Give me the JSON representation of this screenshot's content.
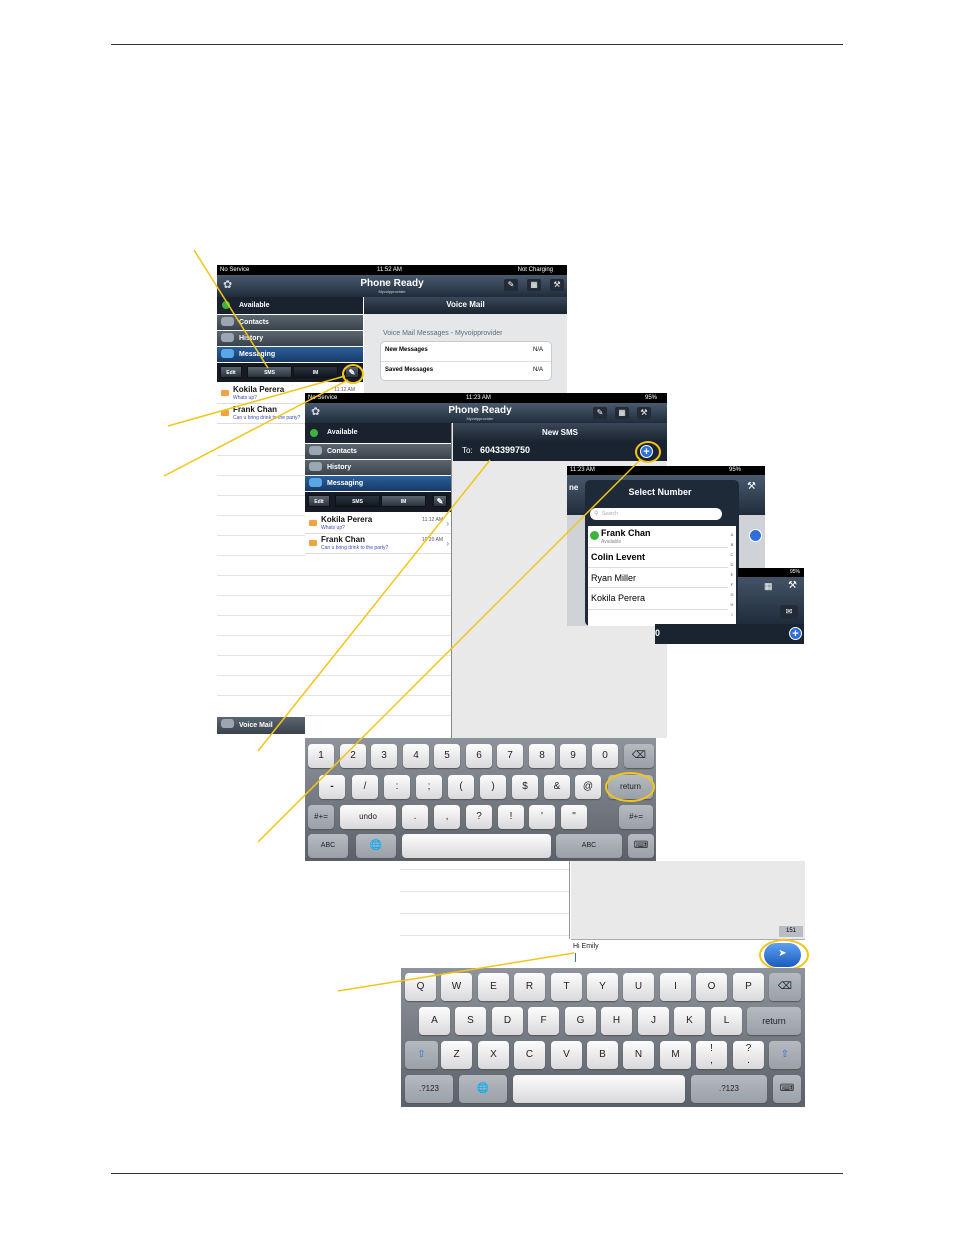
{
  "screen1": {
    "status_left": "No Service",
    "status_time": "11:52 AM",
    "status_right": "Not Charging",
    "title": "Phone Ready",
    "subtitle": "Myvoipprovider",
    "presence": "Available",
    "nav": [
      "Contacts",
      "History",
      "Messaging"
    ],
    "seg": [
      "Edit",
      "SMS",
      "IM"
    ],
    "panel_title": "Voice Mail",
    "vm_heading": "Voice Mail Messages - Myvoipprovider",
    "vm_rows": [
      {
        "label": "New Messages",
        "value": "N/A"
      },
      {
        "label": "Saved Messages",
        "value": "N/A"
      }
    ],
    "messages": [
      {
        "name": "Kokila Perera",
        "text": "Whats up?",
        "time": "11:12 AM"
      },
      {
        "name": "Frank Chan",
        "text": "Can u bring drink to the party?",
        "time": ""
      }
    ],
    "voicemail_tab": "Voice Mail"
  },
  "screen2": {
    "status_left": "No Service",
    "status_time": "11:23 AM",
    "status_right": "95%",
    "title": "Phone Ready",
    "subtitle": "Myvoipprovider",
    "presence": "Available",
    "nav": [
      "Contacts",
      "History",
      "Messaging"
    ],
    "seg": [
      "Edit",
      "SMS",
      "IM"
    ],
    "panel_title": "New SMS",
    "to_label": "To:",
    "to_number": "6043399750",
    "messages": [
      {
        "name": "Kokila Perera",
        "text": "Whats up?",
        "time": "11:12 AM"
      },
      {
        "name": "Frank Chan",
        "text": "Can u bring drink to the party?",
        "time": "10:20 AM"
      }
    ]
  },
  "screen3": {
    "status_time": "11:23 AM",
    "status_right": "95%",
    "title": "Select Number",
    "search_placeholder": "Search",
    "contacts": [
      {
        "name": "Frank Chan",
        "status": "Available"
      },
      {
        "name": "Colin Levent",
        "status": ""
      },
      {
        "name": "Ryan Miller",
        "status": ""
      },
      {
        "name": "Kokila Perera",
        "status": ""
      }
    ],
    "index": [
      "A",
      "B",
      "C",
      "D",
      "E",
      "F",
      "G",
      "H",
      "I"
    ],
    "side_text": "ne"
  },
  "screen4": {
    "status_right": "95%",
    "to_digit": "0"
  },
  "keyboard_num": {
    "row1": [
      "1",
      "2",
      "3",
      "4",
      "5",
      "6",
      "7",
      "8",
      "9",
      "0"
    ],
    "row2": [
      "-",
      "/",
      ":",
      ";",
      "(",
      ")",
      "$",
      "&",
      "@"
    ],
    "return": "return",
    "row3": [
      "#+=",
      "undo",
      ".",
      ",",
      "?",
      "!",
      "'",
      "\"",
      "#+="
    ],
    "abc": "ABC"
  },
  "compose": {
    "char_count": "151",
    "text": "Hi  Emily"
  },
  "keyboard_alpha": {
    "row1": [
      "Q",
      "W",
      "E",
      "R",
      "T",
      "Y",
      "U",
      "I",
      "O",
      "P"
    ],
    "row2": [
      "A",
      "S",
      "D",
      "F",
      "G",
      "H",
      "J",
      "K",
      "L"
    ],
    "return": "return",
    "row3": [
      "Z",
      "X",
      "C",
      "V",
      "B",
      "N",
      "M",
      "!\n,",
      "?\n."
    ],
    "mode": ".?123"
  },
  "colors": {
    "highlight": "#f3c516",
    "header": "#1f2c3b",
    "link": "#3a4fb8",
    "accent": "#2f6fd8"
  }
}
